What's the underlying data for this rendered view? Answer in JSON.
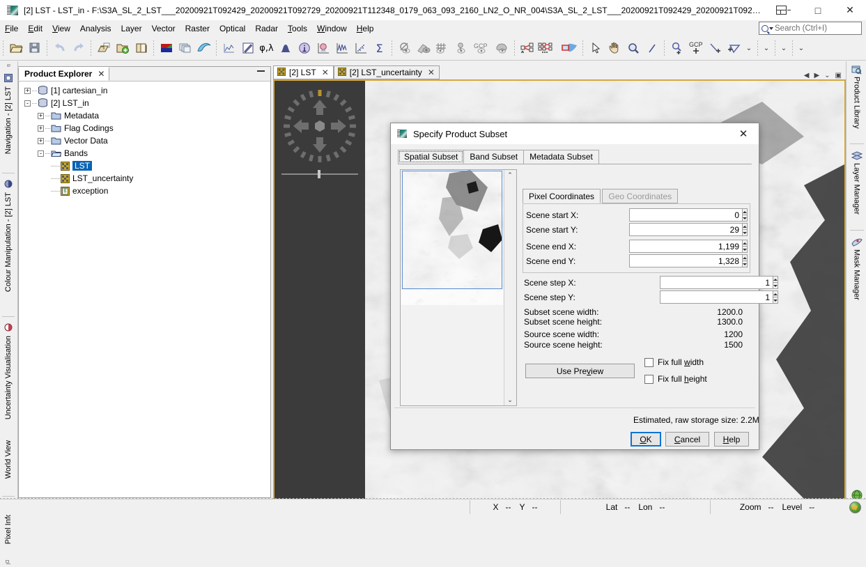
{
  "window": {
    "title": "[2] LST - LST_in - F:\\S3A_SL_2_LST___20200921T092429_20200921T092729_20200921T112348_0179_063_093_2160_LN2_O_NR_004\\S3A_SL_2_LST___20200921T092429_20200921T092729_20200921T112348_017...",
    "icon": "snap-app-icon",
    "buttons": {
      "restore": "restore-split",
      "maximize": "□",
      "close": "✕"
    }
  },
  "menubar": {
    "items": [
      {
        "label": "File",
        "mnemonic": "F"
      },
      {
        "label": "Edit",
        "mnemonic": "E"
      },
      {
        "label": "View",
        "mnemonic": "V"
      },
      {
        "label": "Analysis",
        "mnemonic": ""
      },
      {
        "label": "Layer",
        "mnemonic": ""
      },
      {
        "label": "Vector",
        "mnemonic": ""
      },
      {
        "label": "Raster",
        "mnemonic": ""
      },
      {
        "label": "Optical",
        "mnemonic": ""
      },
      {
        "label": "Radar",
        "mnemonic": ""
      },
      {
        "label": "Tools",
        "mnemonic": "T"
      },
      {
        "label": "Window",
        "mnemonic": "W"
      },
      {
        "label": "Help",
        "mnemonic": "H"
      }
    ],
    "search": {
      "placeholder": "Search (Ctrl+I)",
      "value": ""
    }
  },
  "toolbar": {
    "groups": [
      [
        "open-product-icon",
        "save-product-icon"
      ],
      [
        "undo-icon",
        "redo-icon"
      ],
      [
        "open-rgb-image-window-icon",
        "open-image-window-icon",
        "close-product-icon"
      ],
      [
        "rgb-colour-icon",
        "tile-windows-icon",
        "wave-icon"
      ],
      [
        "spectrum-view-icon",
        "colour-picker-icon",
        "geo-coding-icon",
        "histogram-icon",
        "information-icon",
        "statistics-plot-icon",
        "profile-plot-icon",
        "scatter-plot-icon",
        "sum-icon"
      ],
      [
        "no-data-mask-icon",
        "export-view-icon"
      ],
      [
        "graticule-icon",
        "pin-manager-icon",
        "gcp-manager-icon",
        "mask-icon"
      ],
      [
        "graph-builder-icon",
        "batch-processing-icon",
        "subset-region-icon"
      ],
      [
        "selection-tool-icon",
        "pan-tool-icon",
        "zoom-tool-icon",
        "drawing-tool-icon",
        "magnifier-plus-icon",
        "gcp-placing-icon",
        "line-drawing-icon",
        "polygon-drawing-icon"
      ]
    ]
  },
  "left_strip": {
    "tabs": [
      {
        "label": "Navigation - [2] LST",
        "icon": "navigation-icon"
      },
      {
        "label": "Colour Manipulation - [2] LST",
        "icon": "colour-manipulation-icon"
      },
      {
        "label": "Uncertainty Visualisation",
        "icon": "uncertainty-icon"
      },
      {
        "label": "World View",
        "icon": "world-view-icon"
      },
      {
        "label": "Pixel Info",
        "icon": "pixel-info-icon"
      }
    ]
  },
  "right_strip": {
    "tabs": [
      {
        "label": "Product Library",
        "icon": "product-library-icon"
      },
      {
        "label": "Layer Manager",
        "icon": "layer-manager-icon"
      },
      {
        "label": "Mask Manager",
        "icon": "mask-manager-icon"
      }
    ]
  },
  "product_explorer": {
    "title": "Product Explorer",
    "close_label": "✕",
    "tree": [
      {
        "label": "[1] cartesian_in",
        "icon": "product-icon",
        "indent": 0,
        "expander": "+"
      },
      {
        "label": "[2] LST_in",
        "icon": "product-icon",
        "indent": 0,
        "expander": "-"
      },
      {
        "label": "Metadata",
        "icon": "folder-icon",
        "indent": 1,
        "expander": "+"
      },
      {
        "label": "Flag Codings",
        "icon": "folder-icon",
        "indent": 1,
        "expander": "+"
      },
      {
        "label": "Vector Data",
        "icon": "folder-icon",
        "indent": 1,
        "expander": "+"
      },
      {
        "label": "Bands",
        "icon": "folder-open-icon",
        "indent": 1,
        "expander": "-"
      },
      {
        "label": "LST",
        "icon": "band-icon",
        "indent": 2,
        "expander": "",
        "selected": true
      },
      {
        "label": "LST_uncertainty",
        "icon": "band-icon",
        "indent": 2,
        "expander": ""
      },
      {
        "label": "exception",
        "icon": "flag-band-icon",
        "indent": 2,
        "expander": ""
      }
    ]
  },
  "document_tabs": [
    {
      "label": "[2] LST",
      "icon": "band-icon",
      "active": true,
      "close": "✕"
    },
    {
      "label": "[2] LST_uncertainty",
      "icon": "band-icon",
      "active": false,
      "close": "✕"
    }
  ],
  "dialog": {
    "title": "Specify Product Subset",
    "icon": "snap-app-icon",
    "close_label": "✕",
    "tabs": [
      {
        "label": "Spatial Subset",
        "active": true
      },
      {
        "label": "Band Subset",
        "active": false
      },
      {
        "label": "Metadata Subset",
        "active": false
      }
    ],
    "coord_tabs": [
      {
        "label": "Pixel Coordinates",
        "active": true,
        "disabled": false
      },
      {
        "label": "Geo Coordinates",
        "active": false,
        "disabled": true
      }
    ],
    "fields": [
      {
        "label": "Scene start X:",
        "value": "0"
      },
      {
        "label": "Scene start Y:",
        "value": "29"
      },
      {
        "label": "Scene end X:",
        "value": "1,199"
      },
      {
        "label": "Scene end Y:",
        "value": "1,328"
      }
    ],
    "step_fields": [
      {
        "label": "Scene step X:",
        "value": "1"
      },
      {
        "label": "Scene step Y:",
        "value": "1"
      }
    ],
    "info": [
      {
        "label": "Subset scene width:",
        "value": "1200.0"
      },
      {
        "label": "Subset scene height:",
        "value": "1300.0"
      },
      {
        "label": "Source scene width:",
        "value": "1200"
      },
      {
        "label": "Source scene height:",
        "value": "1500"
      }
    ],
    "use_preview_label": "Use Preview",
    "use_preview_mnemonic": "v",
    "checkboxes": [
      {
        "label_before": "Fix full ",
        "mnemonic": "w",
        "label_after": "idth",
        "checked": false
      },
      {
        "label_before": "Fix full ",
        "mnemonic": "h",
        "label_after": "eight",
        "checked": false
      }
    ],
    "estimate": "Estimated, raw storage size: 2.2M",
    "buttons": [
      {
        "label_before": "",
        "mnemonic": "O",
        "label_after": "K",
        "default": true
      },
      {
        "label_before": "",
        "mnemonic": "C",
        "label_after": "ancel",
        "default": false
      },
      {
        "label_before": "",
        "mnemonic": "H",
        "label_after": "elp",
        "default": false
      }
    ]
  },
  "statusbar": {
    "pixel": {
      "x_label": "X",
      "x_value": "--",
      "y_label": "Y",
      "y_value": "--"
    },
    "geo": {
      "lat_label": "Lat",
      "lat_value": "--",
      "lon_label": "Lon",
      "lon_value": "--"
    },
    "zoom": {
      "zoom_label": "Zoom",
      "zoom_value": "--",
      "level_label": "Level",
      "level_value": "--"
    },
    "globe_icon": "globe-icon"
  },
  "colors": {
    "accent": "#0a64b4",
    "frame_border": "#d2a93c",
    "dialog_bg": "#f0f0f0",
    "default_button": "#0a74d6"
  }
}
